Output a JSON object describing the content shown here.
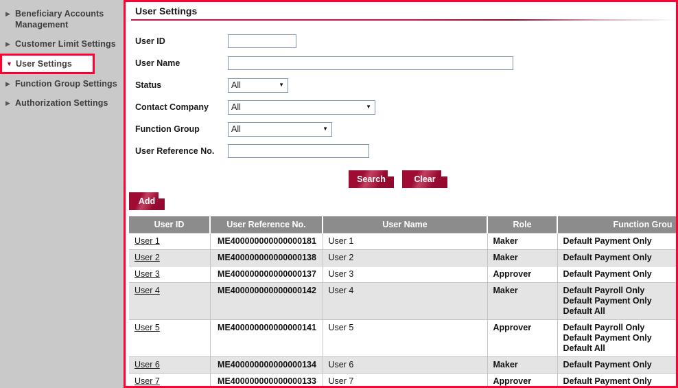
{
  "sidebar": {
    "items": [
      {
        "label": "Beneficiary Accounts Management",
        "arrow": "collapsed-arrow-icon",
        "selected": false
      },
      {
        "label": "Customer Limit Settings",
        "arrow": "collapsed-arrow-icon",
        "selected": false
      },
      {
        "label": "User Settings",
        "arrow": "expanded-arrow-icon",
        "selected": true
      },
      {
        "label": "Function Group Settings",
        "arrow": "collapsed-arrow-icon",
        "selected": false
      },
      {
        "label": "Authorization Settings",
        "arrow": "collapsed-arrow-icon",
        "selected": false
      }
    ]
  },
  "panel": {
    "title": "User Settings"
  },
  "form": {
    "user_id": {
      "label": "User ID",
      "value": "",
      "placeholder": ""
    },
    "user_name": {
      "label": "User Name",
      "value": "",
      "placeholder": ""
    },
    "status": {
      "label": "Status",
      "value": "All",
      "options": [
        "All"
      ]
    },
    "contact_company": {
      "label": "Contact Company",
      "value": "All",
      "options": [
        "All"
      ]
    },
    "function_group": {
      "label": "Function Group",
      "value": "All",
      "options": [
        "All"
      ]
    },
    "user_reference_no": {
      "label": "User Reference No.",
      "value": "",
      "placeholder": ""
    }
  },
  "buttons": {
    "search": "Search",
    "clear": "Clear",
    "add": "Add"
  },
  "table": {
    "headers": {
      "user_id": "User ID",
      "user_reference_no": "User Reference No.",
      "user_name": "User Name",
      "role": "Role",
      "function_group": "Function Grou"
    },
    "rows": [
      {
        "user_id": "User 1",
        "user_reference_no": "ME400000000000000181",
        "user_name": "User 1",
        "role": "Maker",
        "function_groups": [
          "Default Payment Only"
        ]
      },
      {
        "user_id": "User 2",
        "user_reference_no": "ME400000000000000138",
        "user_name": "User 2",
        "role": "Maker",
        "function_groups": [
          "Default Payment Only"
        ]
      },
      {
        "user_id": "User 3",
        "user_reference_no": "ME400000000000000137",
        "user_name": "User 3",
        "role": "Approver",
        "function_groups": [
          "Default Payment Only"
        ]
      },
      {
        "user_id": "User 4",
        "user_reference_no": "ME400000000000000142",
        "user_name": "User 4",
        "role": "Maker",
        "function_groups": [
          "Default Payroll Only",
          "Default Payment Only",
          "Default All"
        ]
      },
      {
        "user_id": "User 5",
        "user_reference_no": "ME400000000000000141",
        "user_name": "User 5",
        "role": "Approver",
        "function_groups": [
          "Default Payroll Only",
          "Default Payment Only",
          "Default All"
        ]
      },
      {
        "user_id": "User 6",
        "user_reference_no": "ME400000000000000134",
        "user_name": "User 6",
        "role": "Maker",
        "function_groups": [
          "Default Payment Only"
        ]
      },
      {
        "user_id": "User 7",
        "user_reference_no": "ME400000000000000133",
        "user_name": "User 7",
        "role": "Approver",
        "function_groups": [
          "Default Payment Only"
        ]
      }
    ]
  },
  "colors": {
    "accent_red": "#ff0033",
    "brand_crimson": "#c8123f",
    "button_dark": "#9e0b33",
    "header_grey": "#8c8c8c",
    "sidebar_grey": "#c9c9c9"
  }
}
